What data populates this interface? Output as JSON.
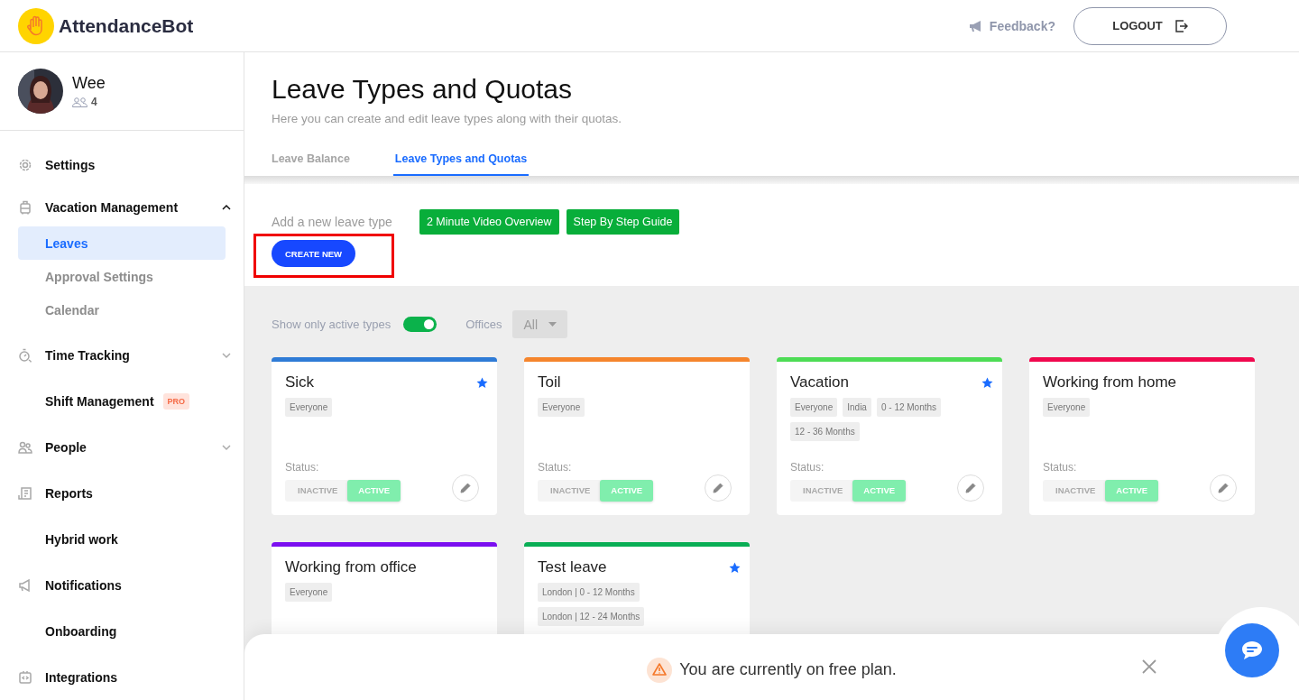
{
  "header": {
    "brand": "AttendanceBot",
    "feedback": "Feedback?",
    "logout": "LOGOUT"
  },
  "profile": {
    "name": "Wee",
    "members": "4"
  },
  "sidebar": {
    "items": [
      {
        "label": "Settings"
      },
      {
        "label": "Vacation Management",
        "expanded": true,
        "children": [
          {
            "label": "Leaves",
            "selected": true
          },
          {
            "label": "Approval Settings",
            "selected": false
          },
          {
            "label": "Calendar",
            "selected": false
          }
        ]
      },
      {
        "label": "Time Tracking",
        "expanded": false
      },
      {
        "label": "Shift Management",
        "badge": "PRO"
      },
      {
        "label": "People",
        "expanded": false
      },
      {
        "label": "Reports"
      },
      {
        "label": "Hybrid work"
      },
      {
        "label": "Notifications"
      },
      {
        "label": "Onboarding"
      },
      {
        "label": "Integrations"
      }
    ]
  },
  "page": {
    "title": "Leave Types and Quotas",
    "subtitle": "Here you can create and edit leave types along with their quotas."
  },
  "tabs": [
    {
      "label": "Leave Balance",
      "selected": false
    },
    {
      "label": "Leave Types and Quotas",
      "selected": true
    }
  ],
  "add_section": {
    "label": "Add a new leave type",
    "guides": [
      "2 Minute Video Overview",
      "Step By Step Guide"
    ],
    "create_button": "CREATE NEW",
    "highlighted": true
  },
  "filters": {
    "toggle_label": "Show only active types",
    "toggle_on": true,
    "offices_label": "Offices",
    "offices_value": "All"
  },
  "cards": [
    {
      "name": "Sick",
      "color": "#2f7bd6",
      "starred": true,
      "tags": [
        "Everyone"
      ],
      "status_label": "Status:",
      "status_options": [
        {
          "label": "INACTIVE",
          "selected": false
        },
        {
          "label": "ACTIVE",
          "selected": true
        }
      ]
    },
    {
      "name": "Toil",
      "color": "#f5852d",
      "starred": false,
      "tags": [
        "Everyone"
      ],
      "status_label": "Status:",
      "status_options": [
        {
          "label": "INACTIVE",
          "selected": false
        },
        {
          "label": "ACTIVE",
          "selected": true
        }
      ]
    },
    {
      "name": "Vacation",
      "color": "#4ddc55",
      "starred": true,
      "tags": [
        "Everyone",
        "India",
        "0 - 12 Months",
        "12 - 36 Months"
      ],
      "status_label": "Status:",
      "status_options": [
        {
          "label": "INACTIVE",
          "selected": false
        },
        {
          "label": "ACTIVE",
          "selected": true
        }
      ]
    },
    {
      "name": "Working from home",
      "color": "#f0084e",
      "starred": false,
      "tags": [
        "Everyone"
      ],
      "status_label": "Status:",
      "status_options": [
        {
          "label": "INACTIVE",
          "selected": false
        },
        {
          "label": "ACTIVE",
          "selected": true
        }
      ]
    },
    {
      "name": "Working from office",
      "color": "#7b0ff0",
      "starred": false,
      "tags": [
        "Everyone"
      ]
    },
    {
      "name": "Test leave",
      "color": "#0aae55",
      "starred": true,
      "tags": [
        "London | 0 - 12 Months",
        "London | 12 - 24 Months"
      ]
    }
  ],
  "banner": {
    "message": "You are currently on free plan."
  }
}
